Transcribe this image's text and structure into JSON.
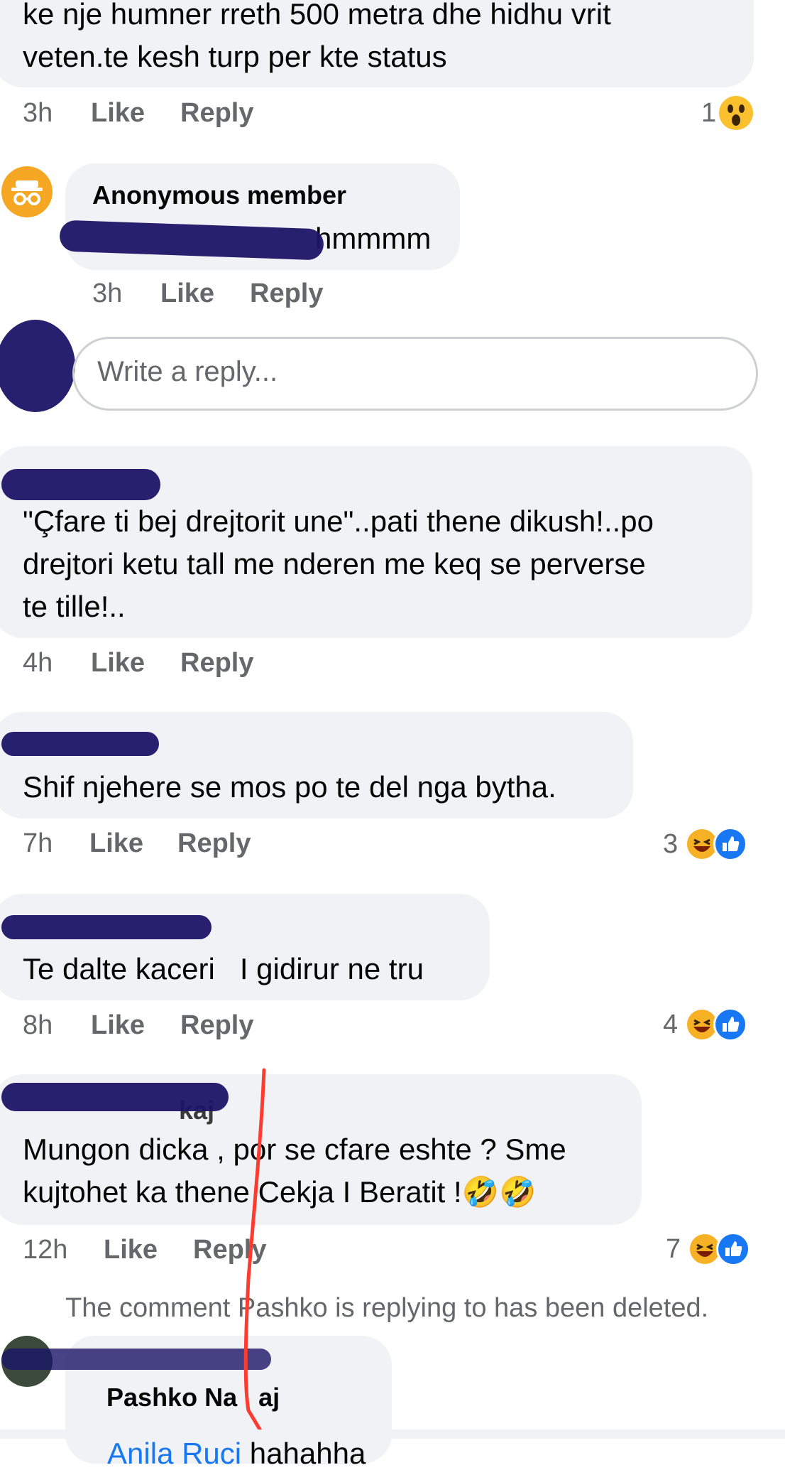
{
  "comments": [
    {
      "id": "c1",
      "text_lines": [
        "ke nje humner rreth 500 metra dhe hidhu vrit",
        "veten.te kesh turp per kte status"
      ],
      "time": "3h",
      "like": "Like",
      "reply": "Reply",
      "reaction_count": "1",
      "reaction_icons": [
        "wow-icon"
      ]
    },
    {
      "id": "c2",
      "author": "Anonymous member",
      "text": "hmmmm",
      "time": "3h",
      "like": "Like",
      "reply": "Reply",
      "avatar_icon": "anonymous-member-icon"
    },
    {
      "id": "c3",
      "text_lines": [
        "\"Çfare ti bej drejtorit une\"..pati thene dikush!..po",
        "drejtori ketu tall me nderen me keq se perverse",
        "te tille!.."
      ],
      "time": "4h",
      "like": "Like",
      "reply": "Reply"
    },
    {
      "id": "c4",
      "text": "Shif njehere se mos po te del nga bytha.",
      "time": "7h",
      "like": "Like",
      "reply": "Reply",
      "reaction_count": "3",
      "reaction_icons": [
        "haha-icon",
        "like-icon"
      ]
    },
    {
      "id": "c5",
      "text": "Te dalte kaceri   I gidirur ne tru",
      "time": "8h",
      "like": "Like",
      "reply": "Reply",
      "reaction_count": "4",
      "reaction_icons": [
        "haha-icon",
        "like-icon"
      ]
    },
    {
      "id": "c6",
      "author_partial": "kaj",
      "text_lines": [
        "Mungon dicka , por se cfare eshte ? Sme",
        "kujtohet ka thene Cekja I Beratit !🤣🤣"
      ],
      "time": "12h",
      "like": "Like",
      "reply": "Reply",
      "reaction_count": "7",
      "reaction_icons": [
        "haha-icon",
        "like-icon"
      ]
    },
    {
      "id": "c7",
      "author_partial": "Pashko Na",
      "author_suffix": "aj",
      "mention": "Anila Ruci",
      "text": "hahahha"
    }
  ],
  "reply_box": {
    "placeholder": "Write a reply..."
  },
  "deleted_notice": "The comment Pashko is replying to has been deleted.",
  "colors": {
    "bubble": "#f0f2f5",
    "muted": "#65676b",
    "link": "#1877f2",
    "redact": "#1a1466",
    "annotation": "#ff3b30"
  }
}
